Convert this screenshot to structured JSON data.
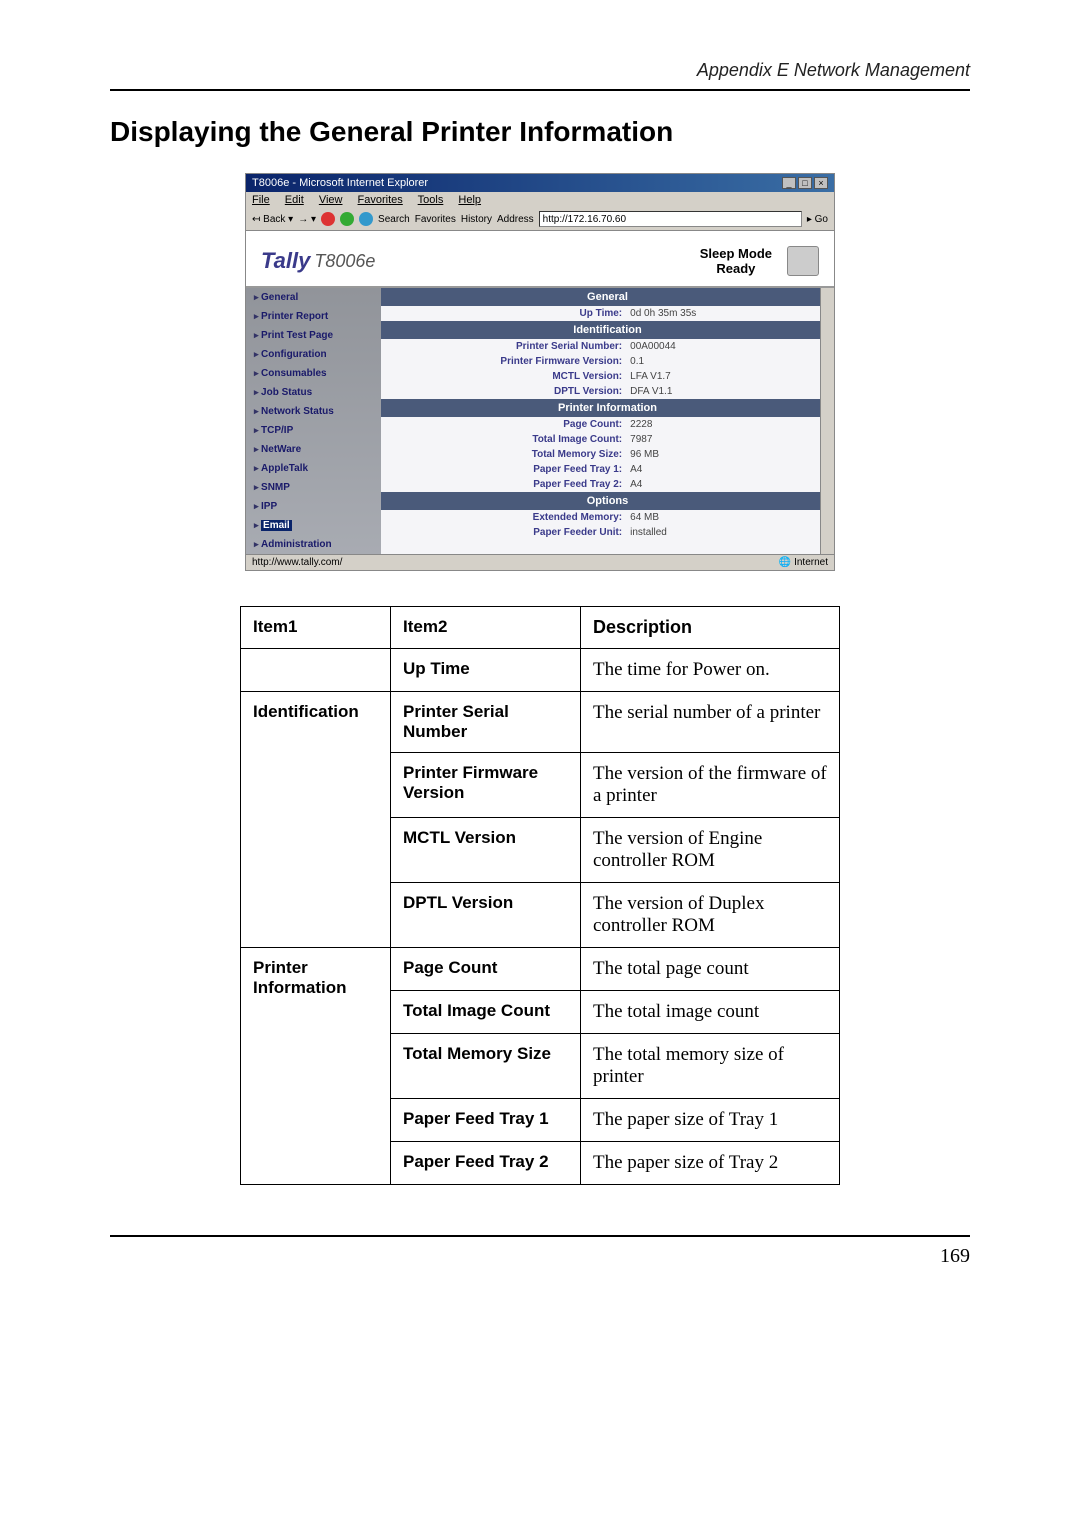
{
  "page": {
    "appendix_header": "Appendix E Network Management",
    "main_title": "Displaying the General Printer Information",
    "page_number": "169"
  },
  "screenshot": {
    "window_title": "T8006e - Microsoft Internet Explorer",
    "menu": {
      "file": "File",
      "edit": "Edit",
      "view": "View",
      "favorites": "Favorites",
      "tools": "Tools",
      "help": "Help"
    },
    "toolbar": {
      "back": "Back",
      "search": "Search",
      "fav": "Favorites",
      "history": "History",
      "address_label": "Address",
      "address_value": "http://172.16.70.60",
      "go": "Go"
    },
    "tally": {
      "brand": "Tally",
      "model": "T8006e",
      "mode1": "Sleep Mode",
      "mode2": "Ready"
    },
    "sidebar": {
      "items": [
        {
          "label": "General"
        },
        {
          "label": "Printer Report"
        },
        {
          "label": "Print Test Page"
        },
        {
          "label": "Configuration"
        },
        {
          "label": "Consumables"
        },
        {
          "label": "Job Status"
        },
        {
          "label": "Network Status"
        },
        {
          "label": "TCP/IP"
        },
        {
          "label": "NetWare"
        },
        {
          "label": "AppleTalk"
        },
        {
          "label": "SNMP"
        },
        {
          "label": "IPP"
        },
        {
          "label": "Email"
        },
        {
          "label": "Administration"
        }
      ]
    },
    "sections": {
      "general": "General",
      "identification": "Identification",
      "printer_info": "Printer Information",
      "options": "Options"
    },
    "rows": {
      "uptime": {
        "label": "Up Time:",
        "value": "0d 0h 35m 35s"
      },
      "serial": {
        "label": "Printer Serial Number:",
        "value": "00A00044"
      },
      "firmware": {
        "label": "Printer Firmware Version:",
        "value": "0.1"
      },
      "mctl": {
        "label": "MCTL Version:",
        "value": "LFA V1.7"
      },
      "dptl": {
        "label": "DPTL Version:",
        "value": "DFA V1.1"
      },
      "pagecount": {
        "label": "Page Count:",
        "value": "2228"
      },
      "imagecount": {
        "label": "Total Image Count:",
        "value": "7987"
      },
      "memory": {
        "label": "Total Memory Size:",
        "value": "96 MB"
      },
      "tray1": {
        "label": "Paper Feed Tray 1:",
        "value": "A4"
      },
      "tray2": {
        "label": "Paper Feed Tray 2:",
        "value": "A4"
      },
      "extmem": {
        "label": "Extended Memory:",
        "value": "64 MB"
      },
      "feeder": {
        "label": "Paper Feeder Unit:",
        "value": "installed"
      }
    },
    "status": {
      "left": "http://www.tally.com/",
      "right": "Internet"
    }
  },
  "table": {
    "headers": {
      "h1": "Item1",
      "h2": "Item2",
      "h3": "Description"
    },
    "rows": [
      {
        "item1": "",
        "item2": "Up Time",
        "desc": "The time for Power on."
      },
      {
        "item1": "Identification",
        "item2": "Printer Serial Number",
        "desc": "The serial number of a printer",
        "rowspan1": 4
      },
      {
        "item2": "Printer Firmware Version",
        "desc": "The version of the firmware of a printer"
      },
      {
        "item2": "MCTL Version",
        "desc": "The version of Engine controller ROM"
      },
      {
        "item2": "DPTL Version",
        "desc": "The version of Duplex controller ROM"
      },
      {
        "item1": "Printer Information",
        "item2": "Page Count",
        "desc": "The total page count",
        "rowspan1": 5
      },
      {
        "item2": "Total Image Count",
        "desc": "The total image count"
      },
      {
        "item2": "Total Memory Size",
        "desc": "The total memory size of printer"
      },
      {
        "item2": "Paper Feed Tray 1",
        "desc": "The paper size of Tray 1"
      },
      {
        "item2": "Paper Feed Tray 2",
        "desc": "The paper size of Tray 2"
      }
    ]
  }
}
